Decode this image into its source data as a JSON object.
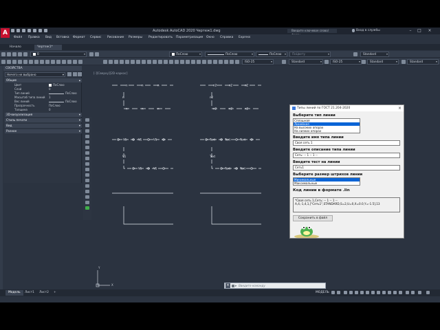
{
  "window": {
    "title": "Autodesk AutoCAD 2020   Чертеж1.dwg",
    "search_placeholder": "Введите ключевое слово/фразу",
    "login": "Вход в службы",
    "logo": "A"
  },
  "menu": [
    "Файл",
    "Правка",
    "Вид",
    "Вставка",
    "Формат",
    "Сервис",
    "Рисование",
    "Размеры",
    "Редактировать",
    "Параметризация",
    "Окно",
    "Справка",
    "Express"
  ],
  "doc_tabs": [
    "Начало",
    "Чертеж1*"
  ],
  "toolbar1": {
    "layer": "0",
    "color": "ПоСлою",
    "linetype": "ПоСлою",
    "lineweight": "ПоСлою",
    "plotstyle": "ПоЦвету",
    "style": "Standard"
  },
  "toolbar2": {
    "dimstyle1": "ISO-25",
    "textstyle": "Standard",
    "dimstyle2": "ISO-25",
    "tablestyle": "Standard",
    "mleaderstyle": "Standard"
  },
  "properties": {
    "title": "СВОЙСТВА",
    "selection": "Ничего не выбрано",
    "sections": {
      "general": "Общие",
      "viz3d": "3D-визуализация",
      "plotstyle": "Стиль печати",
      "view": "Вид",
      "misc": "Разное"
    },
    "rows": [
      {
        "k": "Цвет",
        "v": "ПоСлою"
      },
      {
        "k": "Слой",
        "v": "0"
      },
      {
        "k": "Тип линий",
        "v": "ПоСлою"
      },
      {
        "k": "Масштаб типа линий",
        "v": "1"
      },
      {
        "k": "Вес линий",
        "v": "ПоСлою"
      },
      {
        "k": "Прозрачность",
        "v": "ПоСлою"
      },
      {
        "k": "Толщина",
        "v": "0"
      }
    ]
  },
  "canvas": {
    "viewport_label": "[-][Сверху][2D-каркас]",
    "drawing_labels": {
      "n": "n",
      "n2": "n2",
      "v1": "V1",
      "text": "Text"
    },
    "axis_y": "Y",
    "axis_x": "X"
  },
  "dialog": {
    "title": "Типы линий по ГОСТ 21.204-2020",
    "close": "×",
    "label_type": "Выберите тип линии",
    "type_options": [
      "Сплошная",
      "Линейная",
      "На высоких опорах",
      "На низких опорах"
    ],
    "type_selected": 1,
    "label_name": "Введите имя типа линии",
    "name_value": "Своя сеть 1",
    "label_desc": "Введите описание типа линии",
    "desc_value": "Сеть: -- 1 -- 1 --",
    "label_text": "Введите тест на линии",
    "text_value": "Сеть1",
    "label_size": "Выберите размер штрихов линии",
    "size_options": [
      "Минимальные",
      "Максимальные"
    ],
    "size_selected": 0,
    "label_code": "Код линии в формате .lin",
    "code_line1": "*Своя сеть 1,Сеть: -- 1 -- 1 --",
    "code_line2": "A,4,-1,4,1,[\"Сеть1\",STANDARD,S=2,U=0,X=0.0,Y=-1.5],13",
    "save_button": "Сохранить в файл"
  },
  "command_line": {
    "placeholder": "Введите команду"
  },
  "layout_tabs": [
    "Модель",
    "Лист1",
    "Лист2"
  ],
  "status": {
    "model": "МОДЕЛЬ"
  },
  "colors": {
    "app_bg": "#2b3340",
    "accent": "#0a64d6",
    "brand": "#c8102e"
  }
}
